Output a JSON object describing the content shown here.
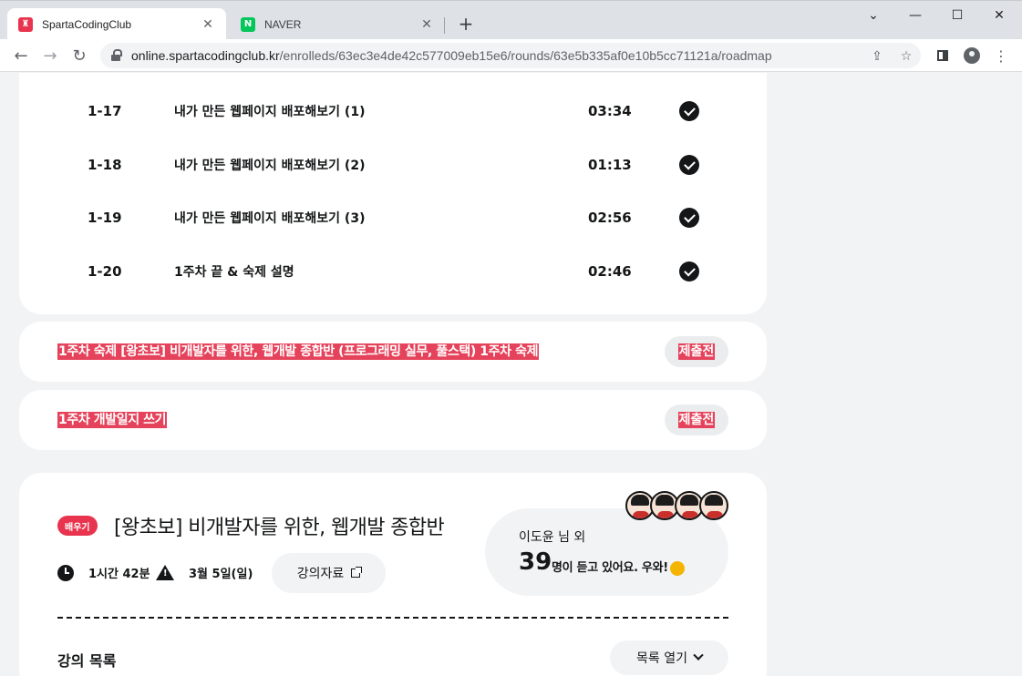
{
  "browser": {
    "tabs": [
      {
        "title": "SpartaCodingClub",
        "favicon": "sparta-favicon",
        "active": true
      },
      {
        "title": "NAVER",
        "favicon": "naver-favicon",
        "active": false
      }
    ],
    "url_host": "online.spartacodingclub.kr",
    "url_path": "/enrolleds/63ec3e4de42c577009eb15e6/rounds/63e5b335af0e10b5cc71121a/roadmap"
  },
  "lessons": [
    {
      "num": "1-17",
      "title": "내가 만든 웹페이지 배포해보기 (1)",
      "time": "03:34"
    },
    {
      "num": "1-18",
      "title": "내가 만든 웹페이지 배포해보기 (2)",
      "time": "01:13"
    },
    {
      "num": "1-19",
      "title": "내가 만든 웹페이지 배포해보기 (3)",
      "time": "02:56"
    },
    {
      "num": "1-20",
      "title": "1주차 끝 & 숙제 설명",
      "time": "02:46"
    }
  ],
  "homework": [
    {
      "title": "1주차 숙제 [왕초보] 비개발자를 위한, 웹개발 종합반 (프로그래밍 실무, 풀스택) 1주차 숙제",
      "status": "제출전"
    },
    {
      "title": "1주차 개발일지 쓰기",
      "status": "제출전"
    }
  ],
  "course": {
    "badge": "배우기",
    "title": "[왕초보] 비개발자를 위한, 웹개발 종합반",
    "duration": "1시간 42분",
    "deadline": "3월 5일(일)",
    "materials_label": "강의자료",
    "listener_name": "이도윤 님 외",
    "listener_count": "39",
    "listener_text": "명이 듣고 있어요. 우와!",
    "list_label": "강의 목록",
    "list_toggle": "목록 열기"
  },
  "colors": {
    "accent": "#e8344e",
    "text": "#141617",
    "background": "#f1f3f5"
  }
}
